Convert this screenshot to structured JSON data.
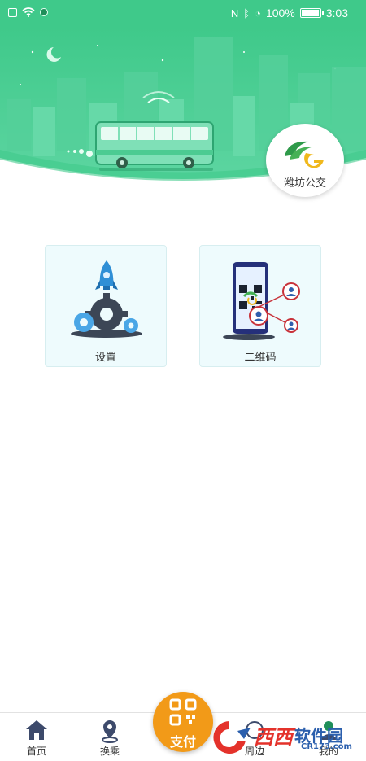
{
  "status_bar": {
    "battery_text": "100%",
    "time": "3:03",
    "battery_level": 1.0
  },
  "brand": {
    "name": "潍坊公交",
    "primary_color": "#3fc98a",
    "accent_color": "#f29a18"
  },
  "features": [
    {
      "label": "设置",
      "icon": "rocket-gear-icon"
    },
    {
      "label": "二维码",
      "icon": "phone-qr-icon"
    }
  ],
  "bottom_nav": {
    "items": [
      {
        "label": "首页",
        "icon": "home-icon"
      },
      {
        "label": "换乘",
        "icon": "transfer-pin-icon"
      },
      {
        "label": "周边",
        "icon": "nearby-icon"
      },
      {
        "label": "我的",
        "icon": "user-icon"
      }
    ],
    "pay": {
      "label": "支付",
      "icon": "qr-pay-icon"
    }
  },
  "watermark": {
    "brand": "西西",
    "subtitle": "软件园",
    "url": "CR173.com"
  }
}
